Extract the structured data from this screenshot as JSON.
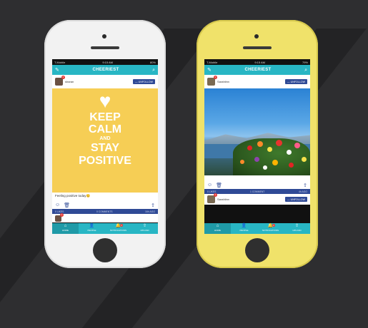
{
  "left_phone": {
    "status": {
      "carrier": "T-Mobile",
      "time": "9:15 AM",
      "battery": "80%"
    },
    "nav": {
      "title": "CHEERIEST",
      "compose_icon": "compose-icon",
      "search_icon": "search-icon"
    },
    "post": {
      "username": "sharan",
      "badge": "2",
      "follow_label": "— UNFOLLOW",
      "poster": {
        "line1": "KEEP",
        "line2": "CALM",
        "line3": "AND",
        "line4": "STAY",
        "line5": "POSITIVE"
      },
      "caption": "Feeling positive today😊",
      "likes": "0 LIKES",
      "comments": "0 COMMENTS",
      "age": "16h AGO"
    },
    "next_post": {
      "badge": "2"
    },
    "tabs": [
      {
        "label": "HOME",
        "icon": "home-icon"
      },
      {
        "label": "PEOPLE",
        "icon": "people-icon"
      },
      {
        "label": "NOTIFICATIONS",
        "icon": "bell-icon",
        "badge": "1"
      },
      {
        "label": "UPLOAD",
        "icon": "upload-icon"
      }
    ]
  },
  "right_phone": {
    "status": {
      "carrier": "T-Mobile",
      "time": "9:15 AM",
      "battery": "79%"
    },
    "nav": {
      "title": "CHEERIEST",
      "compose_icon": "compose-icon",
      "search_icon": "search-icon"
    },
    "post": {
      "username": "Sarahlinn",
      "badge": "2",
      "follow_label": "— UNFOLLOW",
      "likes": "0 LIKES",
      "comments": "1 COMMENT",
      "age": "4h AGO"
    },
    "next_post": {
      "username": "Sarahlinn",
      "badge": "2",
      "follow_label": "— UNFOLLOW"
    },
    "tabs": [
      {
        "label": "HOME",
        "icon": "home-icon"
      },
      {
        "label": "PEOPLE",
        "icon": "people-icon"
      },
      {
        "label": "NOTIFICATIONS",
        "icon": "bell-icon",
        "badge": "1"
      },
      {
        "label": "UPLOAD",
        "icon": "upload-icon"
      }
    ]
  },
  "colors": {
    "accent": "#28b6c4",
    "brand_blue": "#2f4a96",
    "poster_yellow": "#f6ce55",
    "background": "#2e2e30"
  }
}
